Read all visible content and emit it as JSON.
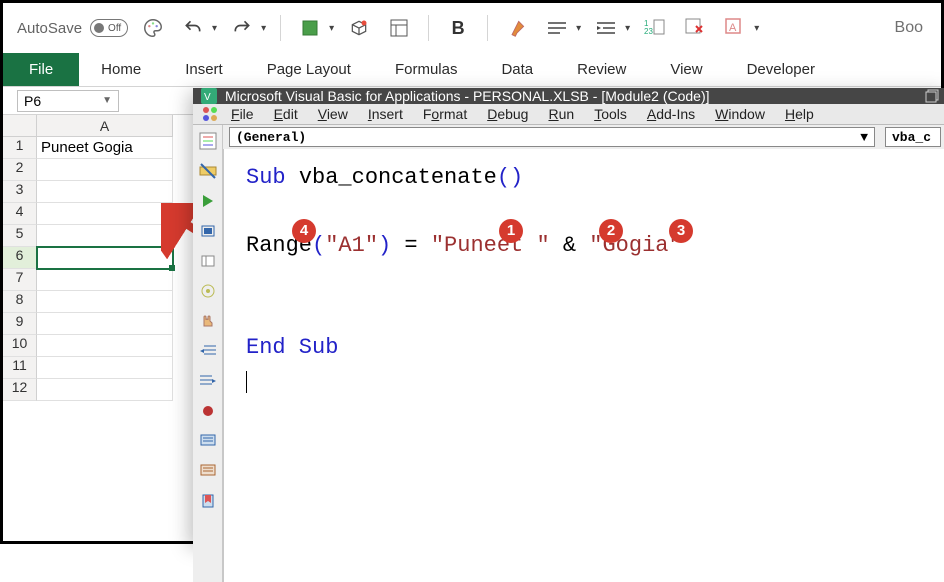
{
  "qat": {
    "autosave": "AutoSave",
    "autosave_state": "Off",
    "book": "Boo"
  },
  "ribbon": {
    "tabs": [
      "File",
      "Home",
      "Insert",
      "Page Layout",
      "Formulas",
      "Data",
      "Review",
      "View",
      "Developer"
    ]
  },
  "namebox": "P6",
  "sheet": {
    "col_header": "A",
    "rows": [
      "1",
      "2",
      "3",
      "4",
      "5",
      "6",
      "7",
      "8",
      "9",
      "10",
      "11",
      "12"
    ],
    "a1_value": "Puneet Gogia",
    "selected_row": 6
  },
  "vba": {
    "title": "Microsoft Visual Basic for Applications - PERSONAL.XLSB - [Module2 (Code)]",
    "menu": [
      "File",
      "Edit",
      "View",
      "Insert",
      "Format",
      "Debug",
      "Run",
      "Tools",
      "Add-Ins",
      "Window",
      "Help"
    ],
    "combo_object": "(General)",
    "combo_proc": "vba_c",
    "code": {
      "sub_kw": "Sub",
      "sub_name": "vba_concatenate",
      "range_fn": "Range",
      "range_arg": "\"A1\"",
      "eq": " = ",
      "str1": "\"Puneet \"",
      "amp": " & ",
      "str2": "\"Gogia\"",
      "end_sub": "End Sub"
    },
    "annotations": {
      "1": "1",
      "2": "2",
      "3": "3",
      "4": "4"
    }
  },
  "icons": {
    "palette": "palette-icon",
    "undo": "undo-icon",
    "redo": "redo-icon",
    "square": "square-icon",
    "cube": "cube-icon",
    "layout": "layout-icon",
    "bold": "bold-icon",
    "brush": "brush-icon",
    "align": "align-icon",
    "indent": "indent-icon",
    "ruler": "ruler-icon",
    "eraser": "eraser-icon",
    "pencil": "pencil-icon"
  }
}
